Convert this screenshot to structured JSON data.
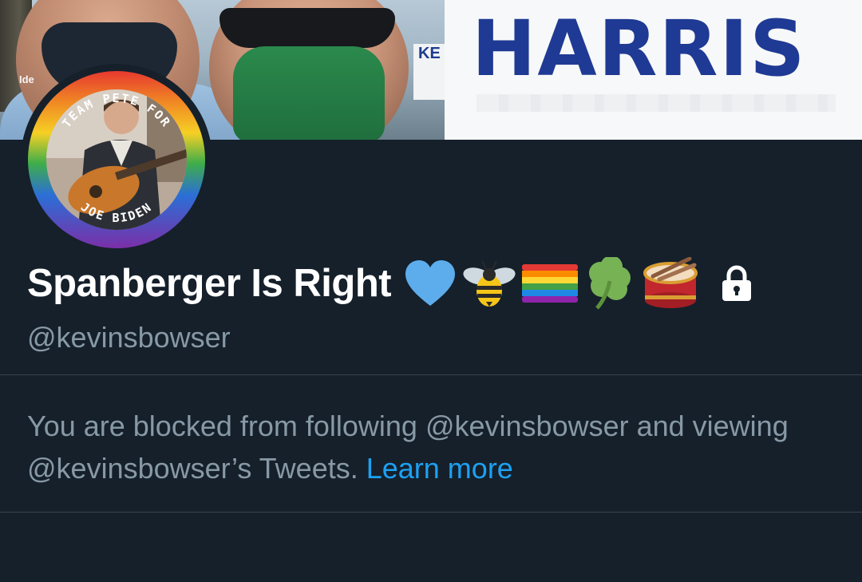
{
  "banner": {
    "sign_text": "KE",
    "sign_left_text": "Ide",
    "harris_text": "HARRIS"
  },
  "avatar": {
    "frame_top_text": "TEAM PETE FOR",
    "frame_bottom_text": "JOE BIDEN"
  },
  "profile": {
    "display_name": "Spanberger Is Right",
    "name_emojis": [
      "blue-heart-icon",
      "bee-icon",
      "rainbow-flag-icon",
      "shamrock-icon",
      "drum-icon"
    ],
    "protected": true,
    "handle": "@kevinsbowser"
  },
  "blocked": {
    "message": "You are blocked from following @kevinsbowser and viewing @kevinsbowser’s Tweets.",
    "link_text": "Learn more"
  },
  "colors": {
    "background": "#15202b",
    "text_primary": "#ffffff",
    "text_secondary": "#8899a6",
    "link": "#1da1f2",
    "divider": "#38444d",
    "harris_blue": "#1f3a94"
  }
}
